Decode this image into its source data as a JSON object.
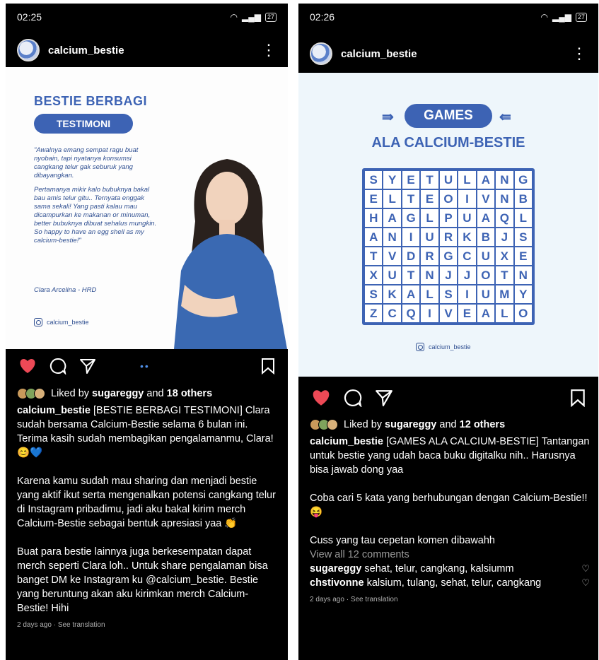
{
  "left": {
    "status": {
      "time": "02:25",
      "battery": "27"
    },
    "username": "calcium_bestie",
    "post_image": {
      "title": "BESTIE BERBAGI",
      "pill": "TESTIMONI",
      "quote_1": "\"Awalnya emang sempat ragu buat nyobain, tapi nyatanya konsumsi cangkang telur gak seburuk yang dibayangkan.",
      "quote_2": "Pertamanya mikir kalo bubuknya bakal bau amis telur gitu.. Ternyata enggak sama sekali! Yang pasti kalau mau dicampurkan ke makanan or minuman, better bubuknya dibuat sehalus mungkin. So happy to have an egg shell as my calcium-bestie!\"",
      "author": "Clara Arcelina - HRD",
      "handle": "calcium_bestie"
    },
    "liked_by_prefix": "Liked by",
    "liked_by_user": "sugareggy",
    "liked_by_and": "and",
    "liked_by_others": "18 others",
    "caption_user": "calcium_bestie",
    "caption_1": "[BESTIE BERBAGI TESTIMONI] Clara sudah bersama Calcium-Bestie selama 6 bulan ini. Terima kasih sudah membagikan pengalamanmu, Clara! 😊💙",
    "caption_2": "Karena kamu sudah mau sharing dan menjadi bestie yang aktif ikut serta mengenalkan potensi cangkang telur di Instagram pribadimu, jadi aku bakal kirim merch Calcium-Bestie sebagai bentuk apresiasi yaa 👏",
    "caption_3": "Buat para bestie lainnya juga berkesempatan dapat merch seperti Clara loh.. Untuk share pengalaman bisa banget DM ke Instagram ku @calcium_bestie. Bestie yang beruntung akan aku kirimkan merch Calcium-Bestie! Hihi",
    "timestamp": "2 days ago · See translation"
  },
  "right": {
    "status": {
      "time": "02:26",
      "battery": "27"
    },
    "username": "calcium_bestie",
    "post_image": {
      "games": "GAMES",
      "subtitle": "ALA CALCIUM-BESTIE",
      "handle": "calcium_bestie",
      "grid": [
        [
          "S",
          "Y",
          "E",
          "T",
          "U",
          "L",
          "A",
          "N",
          "G"
        ],
        [
          "E",
          "L",
          "T",
          "E",
          "O",
          "I",
          "V",
          "N",
          "B"
        ],
        [
          "H",
          "A",
          "G",
          "L",
          "P",
          "U",
          "A",
          "Q",
          "L"
        ],
        [
          "A",
          "N",
          "I",
          "U",
          "R",
          "K",
          "B",
          "J",
          "S"
        ],
        [
          "T",
          "V",
          "D",
          "R",
          "G",
          "C",
          "U",
          "X",
          "E"
        ],
        [
          "X",
          "U",
          "T",
          "N",
          "J",
          "J",
          "O",
          "T",
          "N"
        ],
        [
          "S",
          "K",
          "A",
          "L",
          "S",
          "I",
          "U",
          "M",
          "Y"
        ],
        [
          "Z",
          "C",
          "Q",
          "I",
          "V",
          "E",
          "A",
          "L",
          "O"
        ]
      ]
    },
    "liked_by_prefix": "Liked by",
    "liked_by_user": "sugareggy",
    "liked_by_and": "and",
    "liked_by_others": "12 others",
    "caption_user": "calcium_bestie",
    "caption_1": "[GAMES ALA CALCIUM-BESTIE] Tantangan untuk bestie yang udah baca buku digitalku nih.. Harusnya bisa jawab dong yaa",
    "caption_2": "Coba cari 5 kata yang berhubungan dengan Calcium-Bestie!!😝",
    "caption_3": "Cuss yang tau cepetan komen dibawahh",
    "view_all": "View all 12 comments",
    "comments": [
      {
        "user": "sugareggy",
        "text": "sehat, telur, cangkang, kalsiumm"
      },
      {
        "user": "chstivonne",
        "text": "kalsium, tulang, sehat, telur, cangkang"
      }
    ],
    "timestamp": "2 days ago · See translation"
  },
  "colors": {
    "brand_blue": "#3d63b4",
    "like_red": "#ed4956",
    "background": "#000000"
  }
}
